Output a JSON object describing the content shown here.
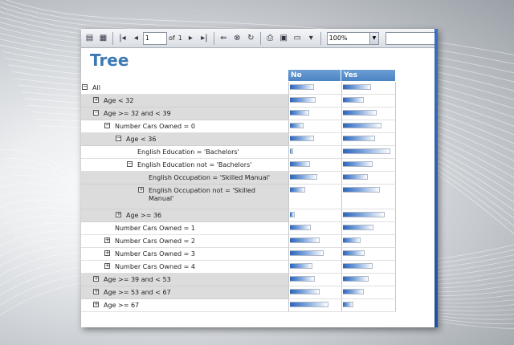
{
  "toolbar": {
    "page_current": "1",
    "page_of": "of",
    "page_total": "1",
    "zoom_value": "100%",
    "icons": [
      "document-map-icon",
      "parameters-icon",
      "first-page-icon",
      "previous-page-icon",
      "next-page-icon",
      "last-page-icon",
      "back-icon",
      "stop-icon",
      "refresh-icon",
      "print-icon",
      "print-layout-icon",
      "page-setup-icon",
      "export-icon"
    ]
  },
  "report": {
    "title": "Tree",
    "columns": [
      "No",
      "Yes"
    ]
  },
  "rows": [
    {
      "label": "All",
      "toggle": "−",
      "indent": 0,
      "shade": false,
      "no": 0.48,
      "yes": 0.55
    },
    {
      "label": "Age < 32",
      "toggle": "+",
      "indent": 1,
      "shade": true,
      "no": 0.52,
      "yes": 0.4
    },
    {
      "label": "Age >= 32 and < 39",
      "toggle": "−",
      "indent": 1,
      "shade": true,
      "no": 0.38,
      "yes": 0.65
    },
    {
      "label": "Number Cars Owned = 0",
      "toggle": "−",
      "indent": 2,
      "shade": false,
      "no": 0.28,
      "yes": 0.75
    },
    {
      "label": "Age < 36",
      "toggle": "−",
      "indent": 3,
      "shade": true,
      "no": 0.48,
      "yes": 0.62
    },
    {
      "label": "English Education = 'Bachelors'",
      "toggle": "",
      "indent": 4,
      "shade": false,
      "no": 0.06,
      "yes": 0.92
    },
    {
      "label": "English Education not = 'Bachelors'",
      "toggle": "−",
      "indent": 4,
      "shade": false,
      "no": 0.4,
      "yes": 0.58
    },
    {
      "label": "English Occupation  = 'Skilled Manual'",
      "toggle": "",
      "indent": 5,
      "shade": true,
      "no": 0.55,
      "yes": 0.48
    },
    {
      "label": "English Occupation not = 'Skilled Manual'",
      "toggle": "+",
      "indent": 5,
      "shade": true,
      "no": 0.3,
      "yes": 0.72,
      "tall": true
    },
    {
      "label": "Age >= 36",
      "toggle": "+",
      "indent": 3,
      "shade": true,
      "no": 0.1,
      "yes": 0.82
    },
    {
      "label": "Number Cars Owned = 1",
      "toggle": "",
      "indent": 2,
      "shade": false,
      "no": 0.42,
      "yes": 0.6
    },
    {
      "label": "Number Cars Owned = 2",
      "toggle": "+",
      "indent": 2,
      "shade": false,
      "no": 0.6,
      "yes": 0.35
    },
    {
      "label": "Number Cars Owned = 3",
      "toggle": "+",
      "indent": 2,
      "shade": false,
      "no": 0.68,
      "yes": 0.42
    },
    {
      "label": "Number Cars Owned = 4",
      "toggle": "+",
      "indent": 2,
      "shade": false,
      "no": 0.45,
      "yes": 0.58
    },
    {
      "label": "Age >= 39 and < 53",
      "toggle": "+",
      "indent": 1,
      "shade": true,
      "no": 0.5,
      "yes": 0.5
    },
    {
      "label": "Age >= 53 and < 67",
      "toggle": "+",
      "indent": 1,
      "shade": true,
      "no": 0.6,
      "yes": 0.4
    },
    {
      "label": "Age >= 67",
      "toggle": "+",
      "indent": 1,
      "shade": false,
      "no": 0.78,
      "yes": 0.2
    }
  ]
}
